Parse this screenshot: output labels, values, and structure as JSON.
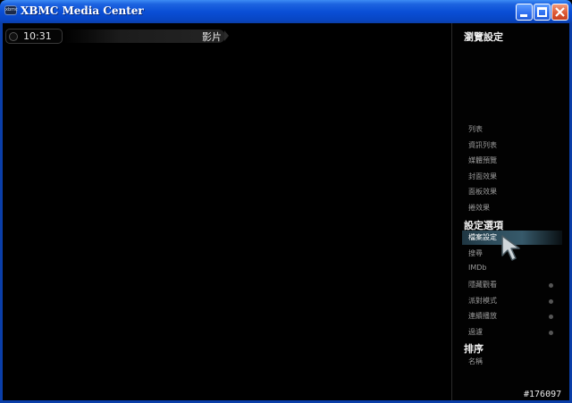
{
  "window": {
    "title": "XBMC Media Center",
    "icon_label": "xbmc"
  },
  "header": {
    "clock": "10:31",
    "section": "影片"
  },
  "side_panel": {
    "title": "瀏覽設定",
    "view_items": [
      "列表",
      "資訊列表",
      "媒體預覽",
      "封面效果",
      "面板效果",
      "捲效果"
    ],
    "settings_title": "設定選項",
    "settings_items": [
      {
        "label": "檔案設定",
        "selected": true,
        "has_dot": false
      },
      {
        "label": "搜尋",
        "selected": false,
        "has_dot": false
      },
      {
        "label": "IMDb",
        "selected": false,
        "has_dot": false
      },
      {
        "label": "隱藏觀看",
        "selected": false,
        "has_dot": true
      },
      {
        "label": "派對模式",
        "selected": false,
        "has_dot": true
      },
      {
        "label": "連續播放",
        "selected": false,
        "has_dot": true
      },
      {
        "label": "過濾",
        "selected": false,
        "has_dot": true
      }
    ],
    "sort_title": "排序",
    "sort_items": [
      "名稱"
    ]
  },
  "watermark": "#176097",
  "colors": {
    "titlebar": "#0a4fd6",
    "close_button": "#de5a36",
    "highlight": "#36596a",
    "text_dim": "#9a9a9a"
  }
}
